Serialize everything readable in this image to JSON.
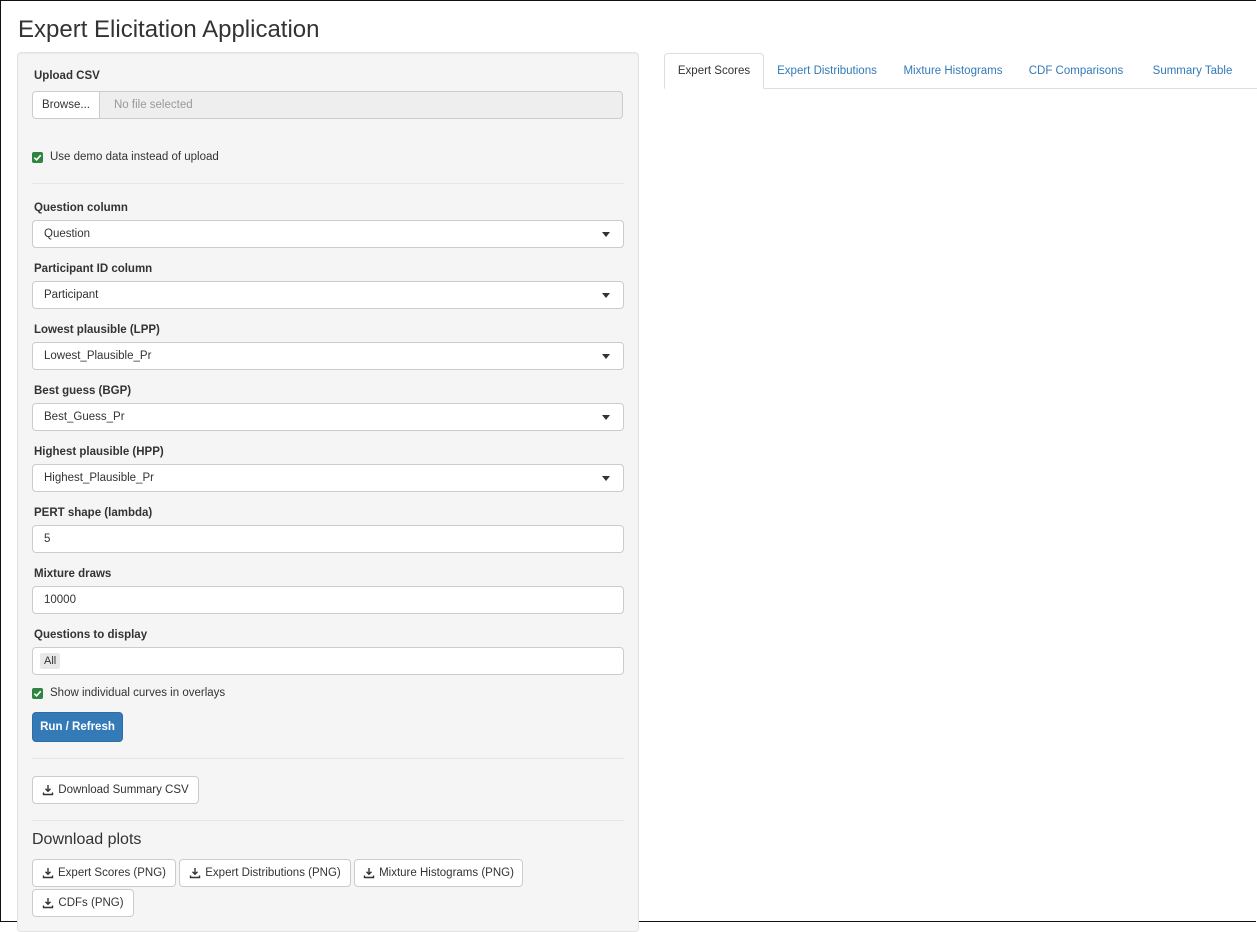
{
  "app_title": "Expert Elicitation Application",
  "upload": {
    "label": "Upload CSV",
    "browse_label": "Browse...",
    "file_status": "No file selected"
  },
  "demo_checkbox": {
    "label": "Use demo data instead of upload",
    "checked": true
  },
  "fields": {
    "question_column": {
      "label": "Question column",
      "value": "Question"
    },
    "participant_column": {
      "label": "Participant ID column",
      "value": "Participant"
    },
    "lpp": {
      "label": "Lowest plausible (LPP)",
      "value": "Lowest_Plausible_Pr"
    },
    "bgp": {
      "label": "Best guess (BGP)",
      "value": "Best_Guess_Pr"
    },
    "hpp": {
      "label": "Highest plausible (HPP)",
      "value": "Highest_Plausible_Pr"
    },
    "pert_shape": {
      "label": "PERT shape (lambda)",
      "value": "5"
    },
    "mixture_draws": {
      "label": "Mixture draws",
      "value": "10000"
    },
    "questions_display": {
      "label": "Questions to display",
      "value": "All"
    }
  },
  "curves_checkbox": {
    "label": "Show individual curves in overlays",
    "checked": true
  },
  "run_button": "Run / Refresh",
  "download_summary": "Download Summary CSV",
  "download_plots": {
    "title": "Download plots",
    "buttons": [
      "Expert Scores (PNG)",
      "Expert Distributions (PNG)",
      "Mixture Histograms (PNG)",
      "CDFs (PNG)"
    ]
  },
  "tabs": [
    "Expert Scores",
    "Expert Distributions",
    "Mixture Histograms",
    "CDF Comparisons",
    "Summary Table"
  ],
  "active_tab": "Expert Scores",
  "colors": {
    "primary": "#337ab7",
    "checkbox": "#2e8540",
    "link": "#337ab7"
  }
}
